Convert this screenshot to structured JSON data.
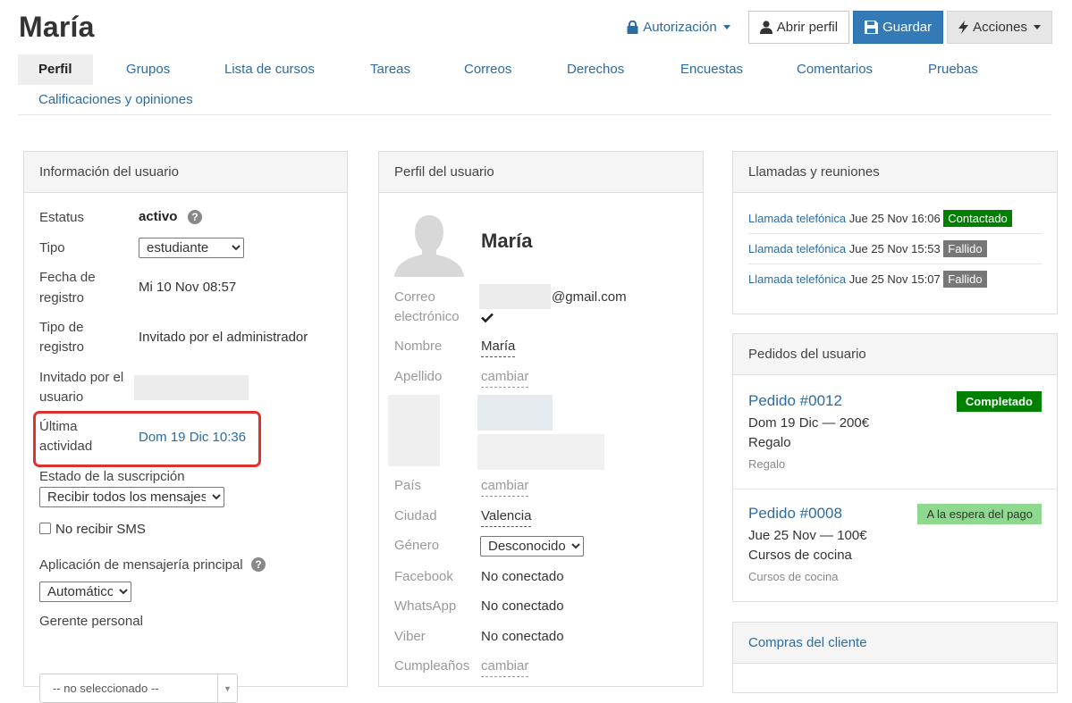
{
  "header": {
    "title": "María",
    "auth_label": "Autorización",
    "open_profile_label": "Abrir perfil",
    "save_label": "Guardar",
    "actions_label": "Acciones"
  },
  "tabs": [
    {
      "label": "Perfil"
    },
    {
      "label": "Grupos"
    },
    {
      "label": "Lista de cursos"
    },
    {
      "label": "Tareas"
    },
    {
      "label": "Correos"
    },
    {
      "label": "Derechos"
    },
    {
      "label": "Encuestas"
    },
    {
      "label": "Comentarios"
    },
    {
      "label": "Pruebas"
    },
    {
      "label": "Calificaciones y opiniones"
    }
  ],
  "user_info": {
    "heading": "Información del usuario",
    "status_label": "Estatus",
    "status_value": "activo",
    "type_label": "Tipo",
    "type_value": "estudiante",
    "reg_date_label_1": "Fecha de",
    "reg_date_label_2": "registro",
    "reg_date_value": "Mi 10 Nov 08:57",
    "reg_type_label_1": "Tipo de",
    "reg_type_label_2": "registro",
    "reg_type_value": "Invitado por el administrador",
    "invited_by_label_1": "Invitado por el",
    "invited_by_label_2": "usuario",
    "last_activity_label_1": "Última",
    "last_activity_label_2": "actividad",
    "last_activity_value": "Dom 19 Dic 10:36",
    "subscription_label": "Estado de la suscripción",
    "subscription_value": "Recibir todos los mensajes",
    "no_sms_label": "No recibir SMS",
    "messenger_label": "Aplicación de mensajería principal",
    "messenger_value": "Automático",
    "manager_label": "Gerente personal",
    "manager_value": "-- no seleccionado --"
  },
  "profile": {
    "heading": "Perfil del usuario",
    "name": "María",
    "email_label_1": "Correo",
    "email_label_2": "electrónico",
    "email_value": "@gmail.com",
    "first_name_label": "Nombre",
    "first_name_value": "María",
    "last_name_label": "Apellido",
    "last_name_value": "cambiar",
    "country_label": "País",
    "country_value": "cambiar",
    "city_label": "Ciudad",
    "city_value": "Valencia",
    "gender_label": "Género",
    "gender_value": "Desconocido",
    "facebook_label": "Facebook",
    "facebook_value": "No conectado",
    "whatsapp_label": "WhatsApp",
    "whatsapp_value": "No conectado",
    "viber_label": "Viber",
    "viber_value": "No conectado",
    "birthday_label": "Cumpleaños",
    "birthday_value": "cambiar"
  },
  "calls": {
    "heading": "Llamadas y reuniones",
    "items": [
      {
        "link": "Llamada telefónica",
        "date": "Jue 25 Nov 16:06",
        "status": "Contactado"
      },
      {
        "link": "Llamada telefónica",
        "date": "Jue 25 Nov 15:53",
        "status": "Fallido"
      },
      {
        "link": "Llamada telefónica",
        "date": "Jue 25 Nov 15:07",
        "status": "Fallido"
      }
    ]
  },
  "orders": {
    "heading": "Pedidos del usuario",
    "items": [
      {
        "title": "Pedido #0012",
        "status": "Completado",
        "line": "Dom 19 Dic — 200€",
        "product": "Regalo",
        "sub": "Regalo"
      },
      {
        "title": "Pedido #0008",
        "status": "A la espera del pago",
        "line": "Jue 25 Nov — 100€",
        "product": "Cursos de cocina",
        "sub": "Cursos de cocina"
      }
    ]
  },
  "purchases": {
    "heading": "Compras del cliente"
  },
  "colors": {
    "link": "#2a6ca3",
    "primary_button": "#337ab7",
    "success": "#008000",
    "muted_badge": "#777777",
    "waiting": "#8fd88f",
    "highlight": "#e03131"
  }
}
